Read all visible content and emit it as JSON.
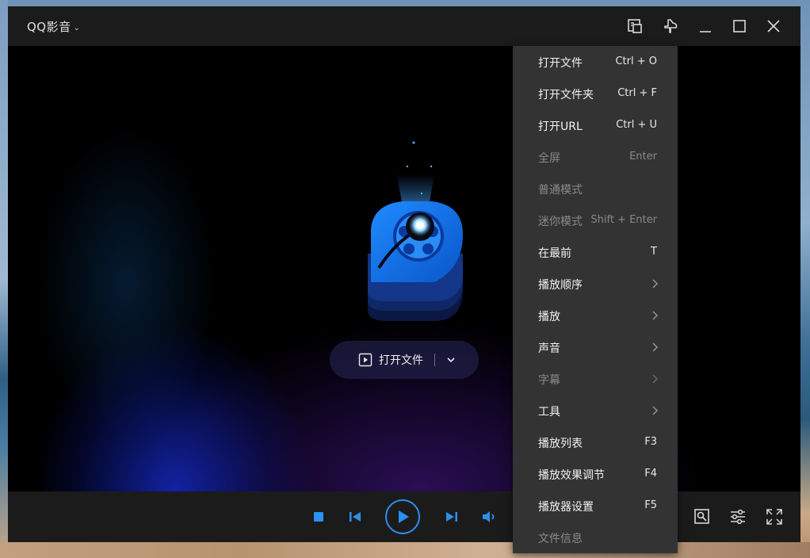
{
  "app": {
    "title": "QQ影音"
  },
  "center": {
    "open_file_label": "打开文件"
  },
  "menu": {
    "items": [
      {
        "label": "打开文件",
        "shortcut": "Ctrl + O",
        "disabled": false,
        "submenu": false
      },
      {
        "label": "打开文件夹",
        "shortcut": "Ctrl + F",
        "disabled": false,
        "submenu": false
      },
      {
        "label": "打开URL",
        "shortcut": "Ctrl + U",
        "disabled": false,
        "submenu": false
      },
      {
        "label": "全屏",
        "shortcut": "Enter",
        "disabled": true,
        "submenu": false
      },
      {
        "label": "普通模式",
        "shortcut": "",
        "disabled": true,
        "submenu": false
      },
      {
        "label": "迷你模式",
        "shortcut": "Shift + Enter",
        "disabled": true,
        "submenu": false
      },
      {
        "label": "在最前",
        "shortcut": "T",
        "disabled": false,
        "submenu": false
      },
      {
        "label": "播放顺序",
        "shortcut": "",
        "disabled": false,
        "submenu": true
      },
      {
        "label": "播放",
        "shortcut": "",
        "disabled": false,
        "submenu": true
      },
      {
        "label": "声音",
        "shortcut": "",
        "disabled": false,
        "submenu": true
      },
      {
        "label": "字幕",
        "shortcut": "",
        "disabled": true,
        "submenu": true
      },
      {
        "label": "工具",
        "shortcut": "",
        "disabled": false,
        "submenu": true
      },
      {
        "label": "播放列表",
        "shortcut": "F3",
        "disabled": false,
        "submenu": false
      },
      {
        "label": "播放效果调节",
        "shortcut": "F4",
        "disabled": false,
        "submenu": false
      },
      {
        "label": "播放器设置",
        "shortcut": "F5",
        "disabled": false,
        "submenu": false
      },
      {
        "label": "文件信息",
        "shortcut": "",
        "disabled": true,
        "submenu": false
      }
    ]
  },
  "colors": {
    "accent": "#2d8ff0",
    "titlebar": "#1b1b1b",
    "menu_bg": "#333333",
    "disabled_text": "#8a8a8a"
  },
  "icons": {
    "titlebar": [
      "screenshot-icon",
      "pin-icon",
      "minimize-icon",
      "maximize-icon",
      "close-icon"
    ],
    "controls": [
      "stop-icon",
      "previous-icon",
      "play-icon",
      "next-icon",
      "volume-icon",
      "snapshot-icon",
      "equalizer-icon",
      "fullscreen-icon"
    ]
  }
}
